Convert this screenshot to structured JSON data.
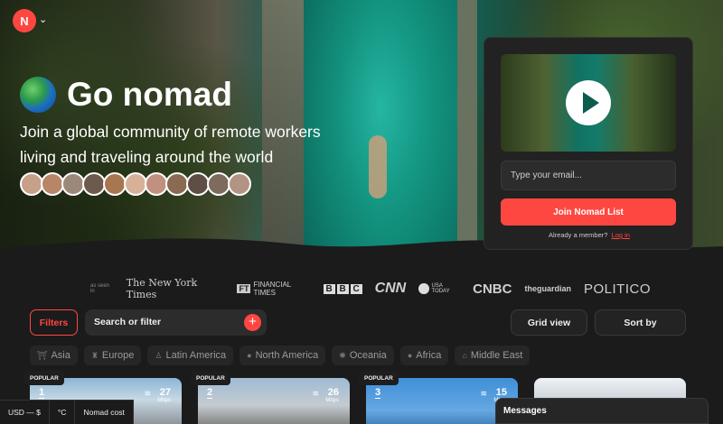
{
  "brand": {
    "logo_letter": "N",
    "accent": "#ff4742"
  },
  "hero": {
    "title": "Go nomad",
    "subtitle": "Join a global community of remote workers living and traveling around the world"
  },
  "signup": {
    "email_placeholder": "Type your email...",
    "join_label": "Join Nomad List",
    "member_text": "Already a member?",
    "login_label": "Log in"
  },
  "press": {
    "seen_in": "as seen in",
    "logos": [
      "The New York Times",
      "FINANCIAL TIMES",
      "BBC",
      "CNN",
      "USA TODAY",
      "CNBC",
      "theguardian",
      "POLITICO"
    ]
  },
  "toolbar": {
    "filters": "Filters",
    "search_placeholder": "Search or filter",
    "grid_view": "Grid view",
    "sort_by": "Sort by"
  },
  "regions": [
    {
      "label": "Asia",
      "icon": "temple-icon"
    },
    {
      "label": "Europe",
      "icon": "castle-icon"
    },
    {
      "label": "Latin America",
      "icon": "monument-icon"
    },
    {
      "label": "North America",
      "icon": "globe-americas-icon"
    },
    {
      "label": "Oceania",
      "icon": "beach-icon"
    },
    {
      "label": "Africa",
      "icon": "globe-africa-icon"
    },
    {
      "label": "Middle East",
      "icon": "mosque-icon"
    }
  ],
  "listings": [
    {
      "badge": "POPULAR",
      "rank": "1",
      "speed": "27",
      "unit": "Mbps"
    },
    {
      "badge": "POPULAR",
      "rank": "2",
      "speed": "26",
      "unit": "Mbps"
    },
    {
      "badge": "POPULAR",
      "rank": "3",
      "speed": "15",
      "unit": "Mbps"
    },
    {
      "badge": "",
      "rank": "",
      "speed": "",
      "unit": ""
    }
  ],
  "bottom_bar": {
    "currency": "USD — $",
    "temperature": "°C",
    "cost": "Nomad cost"
  },
  "messages": {
    "label": "Messages"
  }
}
